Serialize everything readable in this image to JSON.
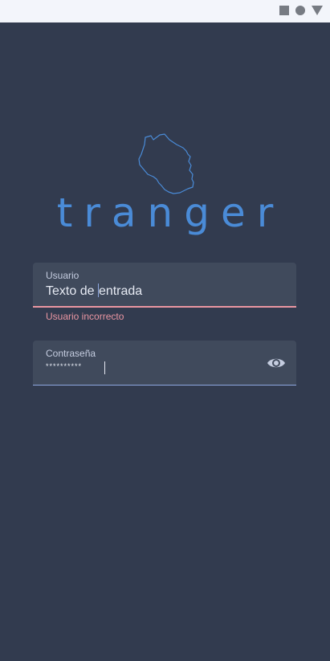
{
  "status_bar": {
    "icons": [
      "stop-square-icon",
      "record-circle-icon",
      "dropdown-triangle-icon"
    ]
  },
  "logo": {
    "map_icon": "tanzania-map-outline-icon",
    "wordmark": "tranger"
  },
  "username": {
    "label": "Usuario",
    "value_before_caret": "Texto de ",
    "value_after_caret": "entrada",
    "error": "Usuario incorrecto"
  },
  "password": {
    "label": "Contraseña",
    "value": "**********",
    "toggle_icon": "eye-icon"
  },
  "colors": {
    "background": "#323b4f",
    "field_bg": "#404a5c",
    "accent": "#4a8bd7",
    "error": "#ea96a2",
    "focus": "#8ea7df"
  }
}
